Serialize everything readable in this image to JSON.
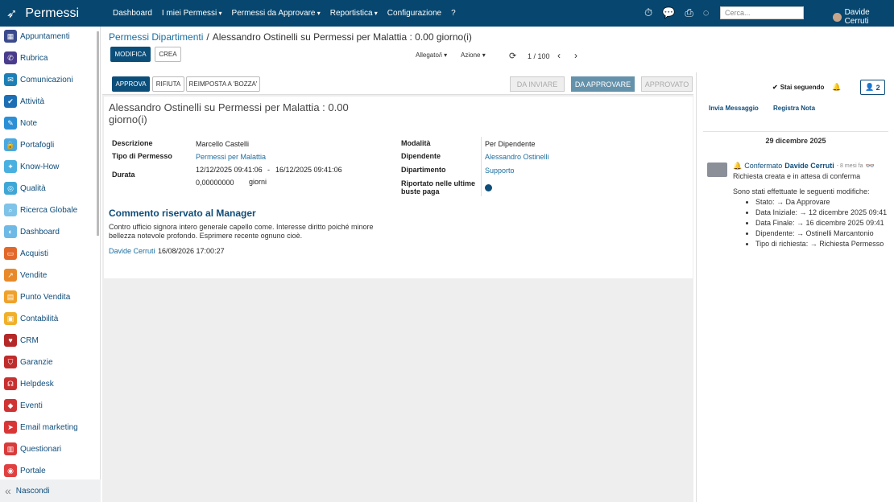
{
  "app": {
    "title": "Permessi"
  },
  "topmenu": [
    {
      "label": "Dashboard"
    },
    {
      "label": "I miei Permessi"
    },
    {
      "label": "Permessi da Approvare"
    },
    {
      "label": "Reportistica"
    },
    {
      "label": "Configurazione"
    },
    {
      "label": "?"
    }
  ],
  "search": {
    "placeholder": "Cerca..."
  },
  "user": {
    "name": "Davide Cerruti"
  },
  "sidebar": {
    "items": [
      {
        "label": "Appuntamenti",
        "icon": "calendar-icon",
        "color": "#3b4a8c"
      },
      {
        "label": "Rubrica",
        "icon": "contacts-icon",
        "color": "#4b3b8c"
      },
      {
        "label": "Comunicazioni",
        "icon": "chat-icon",
        "color": "#1d7fb5"
      },
      {
        "label": "Attività",
        "icon": "checkbox-icon",
        "color": "#1d6fb5"
      },
      {
        "label": "Note",
        "icon": "note-icon",
        "color": "#2b8fd6"
      },
      {
        "label": "Portafogli",
        "icon": "lock-icon",
        "color": "#4aa8e0"
      },
      {
        "label": "Know-How",
        "icon": "lightbulb-icon",
        "color": "#4ab0e0"
      },
      {
        "label": "Qualità",
        "icon": "quality-icon",
        "color": "#3fa7d6"
      },
      {
        "label": "Ricerca Globale",
        "icon": "search-icon",
        "color": "#7fc3e8"
      },
      {
        "label": "Dashboard",
        "icon": "dashboard-icon",
        "color": "#6fb9e6"
      },
      {
        "label": "Acquisti",
        "icon": "cart-icon",
        "color": "#e2682a"
      },
      {
        "label": "Vendite",
        "icon": "chart-icon",
        "color": "#e88a2a"
      },
      {
        "label": "Punto Vendita",
        "icon": "store-icon",
        "color": "#f0a12a"
      },
      {
        "label": "Contabilità",
        "icon": "accounting-icon",
        "color": "#f0b02a"
      },
      {
        "label": "CRM",
        "icon": "handshake-icon",
        "color": "#b52828"
      },
      {
        "label": "Garanzie",
        "icon": "shield-icon",
        "color": "#c02b2b"
      },
      {
        "label": "Helpdesk",
        "icon": "headset-icon",
        "color": "#c83030"
      },
      {
        "label": "Eventi",
        "icon": "ticket-icon",
        "color": "#d03333"
      },
      {
        "label": "Email marketing",
        "icon": "send-icon",
        "color": "#d83636"
      },
      {
        "label": "Questionari",
        "icon": "survey-icon",
        "color": "#d93a3a"
      },
      {
        "label": "Portale",
        "icon": "portal-icon",
        "color": "#e04040"
      }
    ],
    "hide_label": "Nascondi"
  },
  "breadcrumb": {
    "parent": "Permessi Dipartimenti",
    "separator": "/",
    "current": "Alessandro Ostinelli su Permessi per Malattia : 0.00 giorno(i)"
  },
  "actions": {
    "edit": "MODIFICA",
    "create": "CREA",
    "attachments": "Allegato/i",
    "action": "Azione",
    "pager": "1 / 100"
  },
  "statusbar": {
    "approve": "APPROVA",
    "refuse": "RIFIUTA",
    "reset": "REIMPOSTA A 'BOZZA'",
    "stages": [
      "DA INVIARE",
      "DA APPROVARE",
      "APPROVATO"
    ]
  },
  "record": {
    "title": "Alessandro Ostinelli su Permessi per Malattia : 0.00 giorno(i)",
    "labels": {
      "description": "Descrizione",
      "type": "Tipo di Permesso",
      "duration": "Durata",
      "mode": "Modalità",
      "employee": "Dipendente",
      "department": "Dipartimento",
      "payslip": "Riportato nelle ultime buste paga"
    },
    "values": {
      "description": "Marcello Castelli",
      "type": "Permessi per Malattia",
      "date_from": "12/12/2025 09:41:06",
      "date_sep": "-",
      "date_to": "16/12/2025 09:41:06",
      "days": "0,00000000",
      "days_unit": "giorni",
      "mode": "Per Dipendente",
      "employee": "Alessandro Ostinelli",
      "department": "Supporto"
    },
    "comment_title": "Commento riservato al Manager",
    "comment": "Contro ufficio signora intero generale capello come. Interesse diritto poiché minore bellezza notevole profondo. Esprimere recente ognuno cioè.",
    "author": "Davide Cerruti",
    "timestamp": "16/08/2026 17:00:27"
  },
  "chatter": {
    "following": "Stai seguendo",
    "followers": "2",
    "send_message": "Invia Messaggio",
    "log_note": "Registra Nota",
    "date": "29 dicembre 2025",
    "msg": {
      "event": "Confermato",
      "author": "Davide Cerruti",
      "ago": "- 8 mesi fa",
      "line1": "Richiesta creata e in attesa di conferma",
      "line2": "Sono stati effettuate le seguenti modifiche:",
      "changes": [
        "Stato: → Da Approvare",
        "Data Iniziale: → 12 dicembre 2025 09:41",
        "Data Finale: → 16 dicembre 2025 09:41",
        "Dipendente: → Ostinelli Marcantonio",
        "Tipo di richiesta: → Richiesta Permesso"
      ]
    }
  }
}
